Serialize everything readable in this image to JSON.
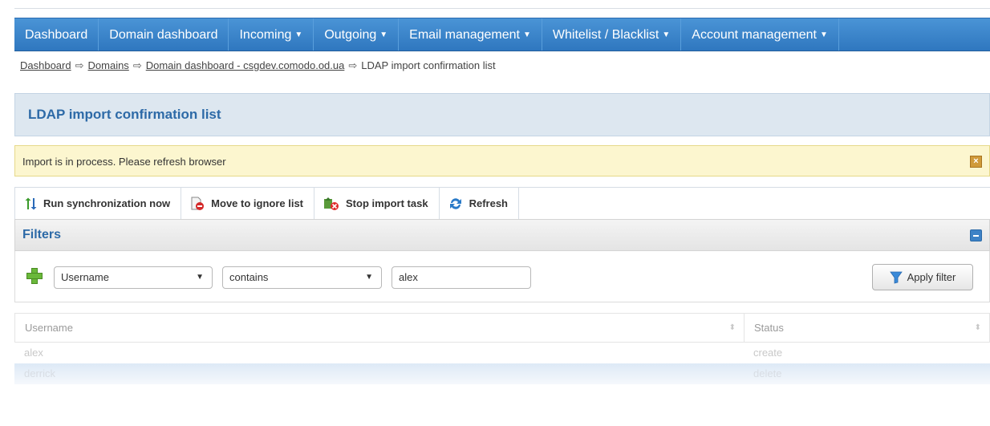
{
  "nav": {
    "items": [
      {
        "label": "Dashboard",
        "dropdown": false
      },
      {
        "label": "Domain dashboard",
        "dropdown": false
      },
      {
        "label": "Incoming",
        "dropdown": true
      },
      {
        "label": "Outgoing",
        "dropdown": true
      },
      {
        "label": "Email management",
        "dropdown": true
      },
      {
        "label": "Whitelist / Blacklist",
        "dropdown": true
      },
      {
        "label": "Account management",
        "dropdown": true
      }
    ]
  },
  "breadcrumb": {
    "items": [
      "Dashboard",
      "Domains",
      "Domain dashboard - csgdev.comodo.od.ua"
    ],
    "current": "LDAP import confirmation list"
  },
  "page": {
    "title": "LDAP import confirmation list"
  },
  "alert": {
    "message": "Import is in process. Please refresh browser"
  },
  "toolbar": {
    "run_sync": "Run synchronization now",
    "move_ignore": "Move to ignore list",
    "stop_import": "Stop import task",
    "refresh": "Refresh"
  },
  "filters": {
    "title": "Filters",
    "field": "Username",
    "operator": "contains",
    "value": "alex",
    "apply_label": "Apply filter"
  },
  "table": {
    "columns": [
      "Username",
      "Status"
    ],
    "rows": [
      {
        "username": "alex",
        "status": "create"
      },
      {
        "username": "derrick",
        "status": "delete"
      }
    ]
  },
  "colors": {
    "nav_blue": "#2f77bf",
    "title_blue": "#2d6aa7",
    "alert_bg": "#fcf6cf",
    "add_green": "#6ab83a"
  }
}
